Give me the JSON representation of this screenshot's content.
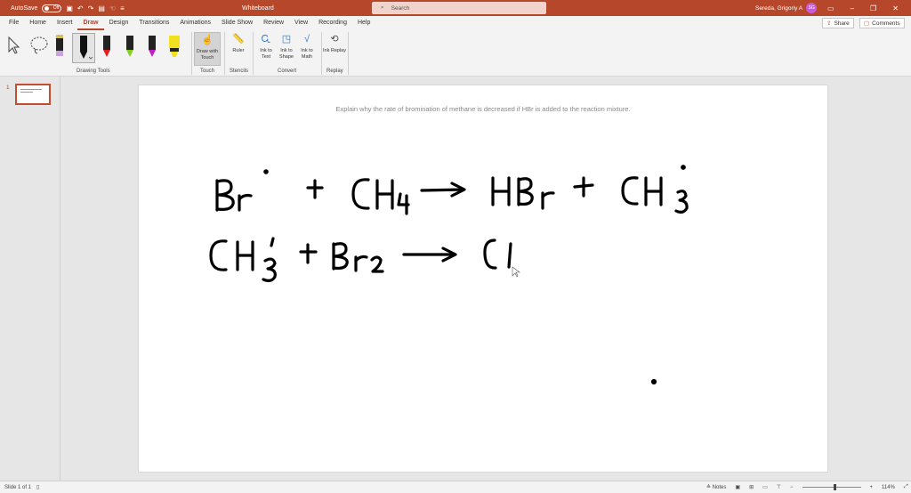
{
  "titlebar": {
    "autosave": "AutoSave",
    "autosave_state": "Off",
    "doc_title": "Whiteboard",
    "search_placeholder": "Search",
    "user_name": "Sereda, Grigoriy A",
    "user_initials": "SG"
  },
  "menu": {
    "tabs": [
      "File",
      "Home",
      "Insert",
      "Draw",
      "Design",
      "Transitions",
      "Animations",
      "Slide Show",
      "Review",
      "View",
      "Recording",
      "Help"
    ],
    "active_tab": "Draw",
    "share": "Share",
    "comments": "Comments"
  },
  "ribbon": {
    "groups": {
      "drawing_tools": "Drawing Tools",
      "touch": "Touch",
      "stencils": "Stencils",
      "convert": "Convert",
      "replay": "Replay"
    },
    "buttons": {
      "draw_with_touch": "Draw with Touch",
      "ruler": "Ruler",
      "ink_to_text": "Ink to Text",
      "ink_to_shape": "Ink to Shape",
      "ink_to_math": "Ink to Math",
      "ink_replay": "Ink Replay"
    },
    "pen_colors": [
      "#e2e2a0",
      "#111111",
      "#e02020",
      "#7fd020",
      "#c020c0",
      "#f0e020"
    ]
  },
  "thumbnails": {
    "slide_number": "1"
  },
  "slide": {
    "question": "Explain why the rate of bromination of methane is decreased if HBr is added to the reaction mixture."
  },
  "statusbar": {
    "slide_info": "Slide 1 of 1",
    "notes": "Notes",
    "zoom": "114%"
  }
}
